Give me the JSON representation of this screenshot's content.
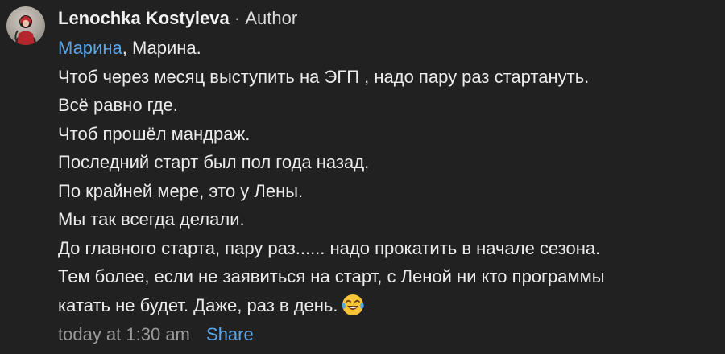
{
  "comment": {
    "author": "Lenochka Kostyleva",
    "separator": "·",
    "author_badge": "Author",
    "mention": "Марина",
    "lines": [
      ", Марина.",
      "Чтоб через месяц выступить на ЭГП , надо пару раз стартануть.",
      "Всё равно где.",
      "Чтоб прошёл мандраж.",
      "Последний старт был пол года назад.",
      "По крайней мере, это у Лены.",
      "Мы так всегда делали.",
      "До главного старта, пару раз...... надо прокатить в начале сезона.",
      "Тем более, если не заявиться на старт, с Леной ни кто программы",
      "катать не будет. Даже, раз в день."
    ],
    "emoji": "face-with-tears-of-joy",
    "timestamp": "today at 1:30 am",
    "share_label": "Share"
  },
  "colors": {
    "background": "#212121",
    "text": "#ececec",
    "link": "#5aa5ea",
    "muted": "#9a9a9a"
  }
}
